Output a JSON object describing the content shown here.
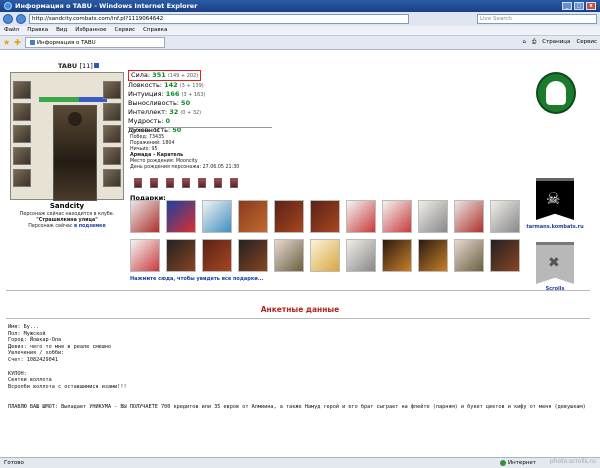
{
  "window": {
    "title": "Информация о TABU - Windows Internet Explorer"
  },
  "address": {
    "url": "http://sandcity.combats.com/inf.pl?1119064642",
    "search_placeholder": "Live Search"
  },
  "menu": [
    "Файл",
    "Правка",
    "Вид",
    "Избранное",
    "Сервис",
    "Справка"
  ],
  "tab": {
    "label": "Информация о TABU"
  },
  "toolbar": {
    "page_label": "Страница",
    "tools_label": "Сервис"
  },
  "character": {
    "nick": "TABU",
    "level": "[11]",
    "hp": "1675/1685",
    "city": "Sandcity",
    "online_note": "Персонаж сейчас находится в клубе.",
    "location": "\"Страшилкина улица\"",
    "online_status_prefix": "Персонаж сейчас",
    "online_status": "в подземке"
  },
  "stats": [
    {
      "label": "Сила:",
      "value": "351",
      "extra": "(149 + 202)"
    },
    {
      "label": "Ловкость:",
      "value": "142",
      "extra": "(3 + 139)"
    },
    {
      "label": "Интуиция:",
      "value": "166",
      "extra": "(3 + 163)"
    },
    {
      "label": "Выносливость:",
      "value": "50",
      "extra": ""
    },
    {
      "label": "Интеллект:",
      "value": "32",
      "extra": "(0 + 32)"
    },
    {
      "label": "Мудрость:",
      "value": "0",
      "extra": ""
    },
    {
      "label": "Духовность:",
      "value": "50",
      "extra": ""
    }
  ],
  "info": {
    "level": "Уровень: 11",
    "wins": "Побед: 73435",
    "losses": "Поражений: 1804",
    "draws": "Ничьих: 95",
    "clan": "Армада - Каратель",
    "birthplace": "Место рождения: Mooncity",
    "birthday": "День рождения персонажа: 27.06.05 21:30"
  },
  "gifts": {
    "label": "Подарки:",
    "more_link": "Нажмите сюда, чтобы увидеть все подарки..."
  },
  "sidebar": {
    "link1": "tarmans.kombats.ru",
    "link2": "Scrolls"
  },
  "anket": {
    "title": "Анкетные данные",
    "name": "Имя: Бу...",
    "sex": "Пол: Мужской",
    "city": "Город: Йошкар-Ола",
    "motto": "Девиз: чего то мне в реале смешно",
    "hobby": "Увлечения / хобби:",
    "account": "Счет: 1082429041",
    "kupon_title": "КУПОН:",
    "kupon_line1": "Святки воллота",
    "kupon_line2": "Всролби воллота с оставшимися изами!!!",
    "promo": "ПЛАВЛЮ ВАШ ШМОТ: Выпадает УНИКУМА - ВЫ ПОЛУЧАЕТЕ 700 кредитов или 35 евров от Алмиина, а также Намуд герой и его брат сыграет на флейте (парням) и букет цветов и кифу от меня (девушкам)"
  },
  "status": {
    "left": "Готово",
    "zone": "Интернет",
    "watermark": "photo.scrolls.ru"
  }
}
